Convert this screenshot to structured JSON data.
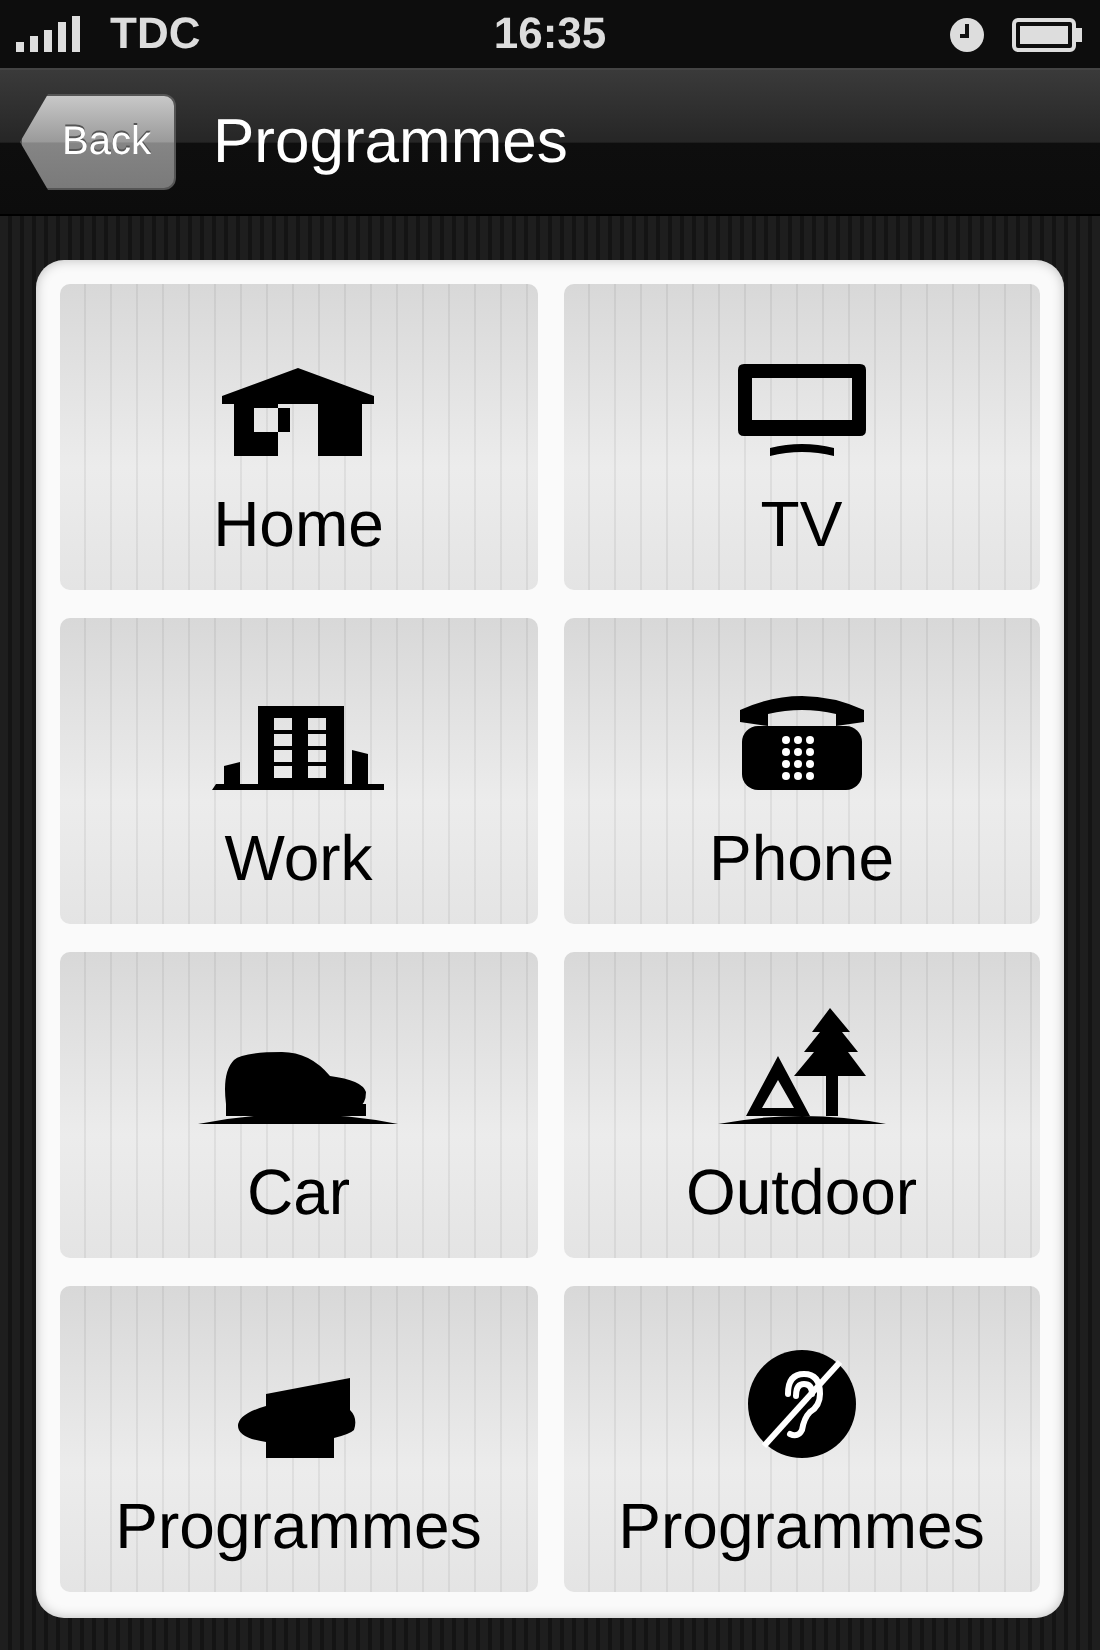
{
  "status_bar": {
    "carrier": "TDC",
    "time": "16:35"
  },
  "nav_bar": {
    "back": "Back",
    "title": "Programmes"
  },
  "tiles": [
    {
      "label": "Home",
      "kind": "home"
    },
    {
      "label": "TV",
      "kind": "tv"
    },
    {
      "label": "Work",
      "kind": "work"
    },
    {
      "label": "Phone",
      "kind": "phone"
    },
    {
      "label": "Car",
      "kind": "car"
    },
    {
      "label": "Outdoor",
      "kind": "outdoor"
    },
    {
      "label": "Programmes",
      "kind": "speaker"
    },
    {
      "label": "Programmes",
      "kind": "hearing"
    }
  ]
}
